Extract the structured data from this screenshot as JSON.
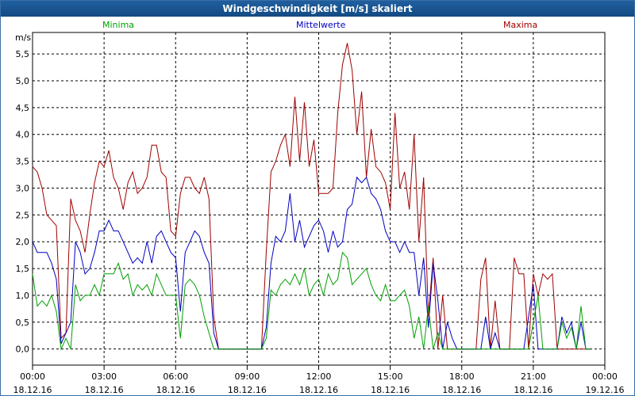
{
  "window": {
    "title": "Windgeschwindigkeit [m/s] skaliert"
  },
  "colors": {
    "minima": "#00a000",
    "mittelwerte": "#0000c0",
    "maxima": "#a00000",
    "grid": "#000000",
    "title_bg": "#1a5592"
  },
  "chart_data": {
    "type": "line",
    "title": "Windgeschwindigkeit [m/s] skaliert",
    "ylabel": "m/s",
    "ylim": [
      -0.3,
      5.9
    ],
    "xlim": [
      0,
      24
    ],
    "grid": true,
    "legend_placement": "top",
    "y_ticks": [
      "0,0",
      "0,5",
      "1,0",
      "1,5",
      "2,0",
      "2,5",
      "3,0",
      "3,5",
      "4,0",
      "4,5",
      "5,0",
      "5,5"
    ],
    "y_tick_values": [
      0,
      0.5,
      1,
      1.5,
      2,
      2.5,
      3,
      3.5,
      4,
      4.5,
      5,
      5.5
    ],
    "x_ticks": [
      {
        "time": "00:00",
        "date": "18.12.16",
        "x": 0
      },
      {
        "time": "03:00",
        "date": "18.12.16",
        "x": 3
      },
      {
        "time": "06:00",
        "date": "18.12.16",
        "x": 6
      },
      {
        "time": "09:00",
        "date": "18.12.16",
        "x": 9
      },
      {
        "time": "12:00",
        "date": "18.12.16",
        "x": 12
      },
      {
        "time": "15:00",
        "date": "18.12.16",
        "x": 15
      },
      {
        "time": "18:00",
        "date": "18.12.16",
        "x": 18
      },
      {
        "time": "21:00",
        "date": "18.12.16",
        "x": 21
      },
      {
        "time": "00:00",
        "date": "19.12.16",
        "x": 24
      }
    ],
    "series": [
      {
        "name": "Minima",
        "x": [
          0,
          0.2,
          0.4,
          0.6,
          0.8,
          1.0,
          1.2,
          1.4,
          1.6,
          1.8,
          2.0,
          2.2,
          2.4,
          2.6,
          2.8,
          3.0,
          3.2,
          3.4,
          3.6,
          3.8,
          4.0,
          4.2,
          4.4,
          4.6,
          4.8,
          5.0,
          5.2,
          5.4,
          5.6,
          5.8,
          6.0,
          6.2,
          6.4,
          6.6,
          6.8,
          7.0,
          7.2,
          7.4,
          7.6,
          7.8,
          8.0,
          9.0,
          9.6,
          9.8,
          10.0,
          10.2,
          10.4,
          10.6,
          10.8,
          11.0,
          11.2,
          11.4,
          11.6,
          11.8,
          12.0,
          12.2,
          12.4,
          12.6,
          12.8,
          13.0,
          13.2,
          13.4,
          13.6,
          13.8,
          14.0,
          14.2,
          14.4,
          14.6,
          14.8,
          15.0,
          15.2,
          15.4,
          15.6,
          15.8,
          16.0,
          16.2,
          16.4,
          16.6,
          16.8,
          17.0,
          17.2,
          17.4,
          17.6,
          17.8,
          18.0,
          18.2,
          18.4,
          18.6,
          18.8,
          19.0,
          19.2,
          19.4,
          19.6,
          19.8,
          20.0,
          20.2,
          20.4,
          20.6,
          20.8,
          21.0,
          21.2,
          21.4,
          21.6,
          21.8,
          22.0,
          22.2,
          22.4,
          22.6,
          22.8,
          23.0,
          23.2,
          23.4
        ],
        "values": [
          1.4,
          0.8,
          0.9,
          0.8,
          1.0,
          0.7,
          0.0,
          0.2,
          0.0,
          1.2,
          0.9,
          1.0,
          1.0,
          1.2,
          1.0,
          1.4,
          1.4,
          1.4,
          1.6,
          1.3,
          1.4,
          1.0,
          1.2,
          1.1,
          1.2,
          1.0,
          1.4,
          1.2,
          1.0,
          1.0,
          1.0,
          0.2,
          1.2,
          1.3,
          1.2,
          1.0,
          0.6,
          0.3,
          0.0,
          0.0,
          0.0,
          0.0,
          0.0,
          0.2,
          1.1,
          1.0,
          1.2,
          1.3,
          1.2,
          1.4,
          1.2,
          1.5,
          1.0,
          1.2,
          1.3,
          1.0,
          1.4,
          1.2,
          1.3,
          1.8,
          1.7,
          1.2,
          1.3,
          1.4,
          1.5,
          1.2,
          1.0,
          0.9,
          1.2,
          0.9,
          0.9,
          1.0,
          1.1,
          0.8,
          0.2,
          0.6,
          0.0,
          0.8,
          0.0,
          0.3,
          0.0,
          0.0,
          0.0,
          0.0,
          0.0,
          0.0,
          0.0,
          0.0,
          0.0,
          0.0,
          0.0,
          0.0,
          0.0,
          0.0,
          0.0,
          0.0,
          0.0,
          0.0,
          0.0,
          0.5,
          1.0,
          0.0,
          0.0,
          0.0,
          0.0,
          0.5,
          0.2,
          0.4,
          0.0,
          0.8,
          0.0,
          0.0
        ]
      },
      {
        "name": "Mittelwerte",
        "x": [
          0,
          0.2,
          0.4,
          0.6,
          0.8,
          1.0,
          1.2,
          1.4,
          1.6,
          1.8,
          2.0,
          2.2,
          2.4,
          2.6,
          2.8,
          3.0,
          3.2,
          3.4,
          3.6,
          3.8,
          4.0,
          4.2,
          4.4,
          4.6,
          4.8,
          5.0,
          5.2,
          5.4,
          5.6,
          5.8,
          6.0,
          6.2,
          6.4,
          6.6,
          6.8,
          7.0,
          7.2,
          7.4,
          7.6,
          7.8,
          8.0,
          9.0,
          9.6,
          9.8,
          10.0,
          10.2,
          10.4,
          10.6,
          10.8,
          11.0,
          11.2,
          11.4,
          11.6,
          11.8,
          12.0,
          12.2,
          12.4,
          12.6,
          12.8,
          13.0,
          13.2,
          13.4,
          13.6,
          13.8,
          14.0,
          14.2,
          14.4,
          14.6,
          14.8,
          15.0,
          15.2,
          15.4,
          15.6,
          15.8,
          16.0,
          16.2,
          16.4,
          16.6,
          16.8,
          17.0,
          17.2,
          17.4,
          17.6,
          17.8,
          18.0,
          18.2,
          18.4,
          18.6,
          18.8,
          19.0,
          19.2,
          19.4,
          19.6,
          19.8,
          20.0,
          20.2,
          20.4,
          20.6,
          20.8,
          21.0,
          21.2,
          21.4,
          21.6,
          21.8,
          22.0,
          22.2,
          22.4,
          22.6,
          22.8,
          23.0,
          23.2,
          23.4
        ],
        "values": [
          2.0,
          1.8,
          1.8,
          1.8,
          1.6,
          1.3,
          0.1,
          0.3,
          0.5,
          2.0,
          1.8,
          1.4,
          1.5,
          1.8,
          2.2,
          2.2,
          2.4,
          2.2,
          2.2,
          2.0,
          1.8,
          1.6,
          1.7,
          1.6,
          2.0,
          1.6,
          2.1,
          2.2,
          2.0,
          1.8,
          1.7,
          0.7,
          1.8,
          2.0,
          2.2,
          2.1,
          1.8,
          1.6,
          0.3,
          0.0,
          0.0,
          0.0,
          0.0,
          0.4,
          1.6,
          2.1,
          2.0,
          2.2,
          2.9,
          2.0,
          2.4,
          1.9,
          2.1,
          2.3,
          2.4,
          2.2,
          1.8,
          2.2,
          1.9,
          2.0,
          2.6,
          2.7,
          3.2,
          3.1,
          3.2,
          2.9,
          2.8,
          2.6,
          2.2,
          2.0,
          2.0,
          1.8,
          2.0,
          1.8,
          1.8,
          1.0,
          1.7,
          0.4,
          1.6,
          0.9,
          0.0,
          0.5,
          0.2,
          0.0,
          0.0,
          0.0,
          0.0,
          0.0,
          0.0,
          0.6,
          0.0,
          0.3,
          0.0,
          0.0,
          0.0,
          0.0,
          0.0,
          0.0,
          0.6,
          1.2,
          0.0,
          0.0,
          0.0,
          0.0,
          0.0,
          0.6,
          0.3,
          0.5,
          0.0,
          0.5,
          0.0,
          0.0
        ]
      },
      {
        "name": "Maxima",
        "x": [
          0,
          0.2,
          0.4,
          0.6,
          0.8,
          1.0,
          1.2,
          1.4,
          1.6,
          1.8,
          2.0,
          2.2,
          2.4,
          2.6,
          2.8,
          3.0,
          3.2,
          3.4,
          3.6,
          3.8,
          4.0,
          4.2,
          4.4,
          4.6,
          4.8,
          5.0,
          5.2,
          5.4,
          5.6,
          5.8,
          6.0,
          6.2,
          6.4,
          6.6,
          6.8,
          7.0,
          7.2,
          7.4,
          7.6,
          7.8,
          8.0,
          9.0,
          9.6,
          9.8,
          10.0,
          10.2,
          10.4,
          10.6,
          10.8,
          11.0,
          11.2,
          11.4,
          11.6,
          11.8,
          12.0,
          12.2,
          12.4,
          12.6,
          12.8,
          13.0,
          13.2,
          13.4,
          13.6,
          13.8,
          14.0,
          14.2,
          14.4,
          14.6,
          14.8,
          15.0,
          15.2,
          15.4,
          15.6,
          15.8,
          16.0,
          16.2,
          16.4,
          16.6,
          16.8,
          17.0,
          17.2,
          17.4,
          17.6,
          17.8,
          18.0,
          18.2,
          18.4,
          18.6,
          18.8,
          19.0,
          19.2,
          19.4,
          19.6,
          19.8,
          20.0,
          20.2,
          20.4,
          20.6,
          20.8,
          21.0,
          21.2,
          21.4,
          21.6,
          21.8,
          22.0,
          22.2,
          22.4,
          22.6,
          22.8,
          23.0,
          23.2,
          23.4
        ],
        "values": [
          3.4,
          3.3,
          3.0,
          2.5,
          2.4,
          2.3,
          0.2,
          0.3,
          2.8,
          2.4,
          2.2,
          1.8,
          2.5,
          3.1,
          3.5,
          3.4,
          3.7,
          3.2,
          3.0,
          2.6,
          3.1,
          3.3,
          2.9,
          3.0,
          3.2,
          3.8,
          3.8,
          3.3,
          3.2,
          2.2,
          2.1,
          2.9,
          3.2,
          3.2,
          3.0,
          2.9,
          3.2,
          2.8,
          0.6,
          0.0,
          0.0,
          0.0,
          0.0,
          1.8,
          3.3,
          3.5,
          3.8,
          4.0,
          3.4,
          4.7,
          3.5,
          4.6,
          3.4,
          3.9,
          2.9,
          2.9,
          2.9,
          3.0,
          4.4,
          5.3,
          5.7,
          5.2,
          4.0,
          4.8,
          3.2,
          4.1,
          3.4,
          3.3,
          3.1,
          2.6,
          4.4,
          3.0,
          3.3,
          2.6,
          4.0,
          2.0,
          3.2,
          0.6,
          1.7,
          0.0,
          1.0,
          0.0,
          0.0,
          0.0,
          0.0,
          0.0,
          0.0,
          0.0,
          1.3,
          1.7,
          0.0,
          0.9,
          0.0,
          0.0,
          0.0,
          1.7,
          1.4,
          1.4,
          0.0,
          1.4,
          1.0,
          1.4,
          1.3,
          1.4,
          0.0,
          0.0,
          0.0,
          0.0,
          0.0,
          0.0,
          0.0,
          0.0
        ]
      }
    ]
  }
}
